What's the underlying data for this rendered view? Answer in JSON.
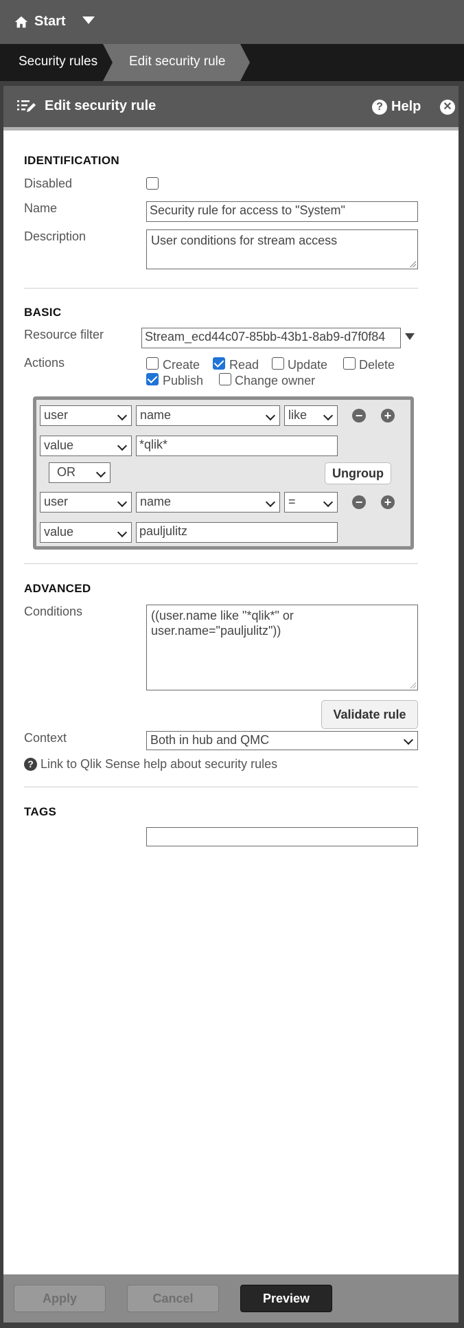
{
  "topbar": {
    "start_label": "Start"
  },
  "breadcrumb": {
    "items": [
      "Security rules",
      "Edit security rule"
    ]
  },
  "panel": {
    "title": "Edit security rule",
    "help_label": "Help"
  },
  "identification": {
    "heading": "IDENTIFICATION",
    "disabled_label": "Disabled",
    "disabled_checked": false,
    "name_label": "Name",
    "name_value": "Security rule for access to \"System\"",
    "description_label": "Description",
    "description_value": "User conditions for stream access"
  },
  "basic": {
    "heading": "BASIC",
    "resource_filter_label": "Resource filter",
    "resource_filter_value": "Stream_ecd44c07-85bb-43b1-8ab9-d7f0f84",
    "actions_label": "Actions",
    "actions": [
      {
        "label": "Create",
        "checked": false
      },
      {
        "label": "Read",
        "checked": true
      },
      {
        "label": "Update",
        "checked": false
      },
      {
        "label": "Delete",
        "checked": false
      },
      {
        "label": "Publish",
        "checked": true
      },
      {
        "label": "Change owner",
        "checked": false
      }
    ],
    "conditions": [
      {
        "left": "user",
        "field": "name",
        "operator": "like",
        "value_type": "value",
        "value": "*qlik*"
      },
      {
        "left": "user",
        "field": "name",
        "operator": "=",
        "value_type": "value",
        "value": "pauljulitz"
      }
    ],
    "joiner": "OR",
    "ungroup_label": "Ungroup"
  },
  "advanced": {
    "heading": "ADVANCED",
    "conditions_label": "Conditions",
    "conditions_value": "((user.name like \"*qlik*\" or user.name=\"pauljulitz\"))",
    "validate_label": "Validate rule",
    "context_label": "Context",
    "context_value": "Both in hub and QMC",
    "help_link": "Link to Qlik Sense help about security rules"
  },
  "tags": {
    "heading": "TAGS",
    "value": ""
  },
  "footer": {
    "apply_label": "Apply",
    "cancel_label": "Cancel",
    "preview_label": "Preview"
  }
}
